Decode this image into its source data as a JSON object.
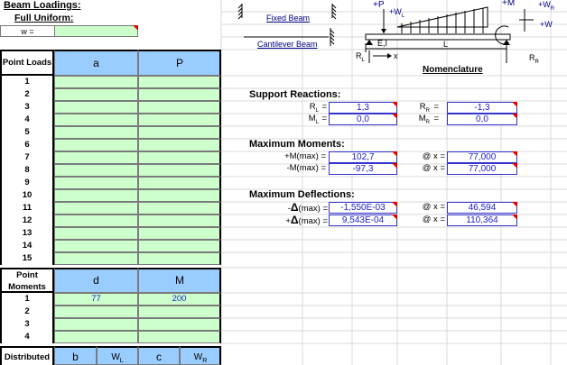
{
  "header": {
    "beam_loadings": "Beam Loadings:",
    "full_uniform": "Full Uniform:",
    "w_label": "w ="
  },
  "point_loads": {
    "title": "Point Loads",
    "col_a": "a",
    "col_p": "P",
    "rows": [
      "1",
      "2",
      "3",
      "4",
      "5",
      "6",
      "7",
      "8",
      "9",
      "10",
      "11",
      "12",
      "13",
      "14",
      "15"
    ]
  },
  "point_moments": {
    "title_line1": "Point",
    "title_line2": "Moments",
    "col_d": "d",
    "col_m": "M",
    "rows": [
      {
        "n": "1",
        "d": "77",
        "m": "200"
      },
      {
        "n": "2",
        "d": "",
        "m": ""
      },
      {
        "n": "3",
        "d": "",
        "m": ""
      },
      {
        "n": "4",
        "d": "",
        "m": ""
      }
    ]
  },
  "distributed": {
    "title": "Distributed",
    "col_b": "b",
    "col_wl": "W",
    "col_wl_sub": "L",
    "col_c": "c",
    "col_wr": "W",
    "col_wr_sub": "R"
  },
  "links": {
    "fixed_beam": "Fixed Beam",
    "cantilever_beam": "Cantilever Beam"
  },
  "diagram": {
    "p_label": "+P",
    "wl_label": "+W",
    "wl_sub": "L",
    "m_label": "+M",
    "wr_label": "+W",
    "wr_sub": "R",
    "w_label": "+W",
    "ei_label": "E,I",
    "l_label": "L",
    "rl_label": "R",
    "rl_sub": "L",
    "rr_label": "R",
    "rr_sub": "R",
    "x_label": "x",
    "nomenclature": "Nomenclature"
  },
  "support_reactions": {
    "title": "Support Reactions:",
    "rl_label": "R",
    "rl_sub": "L",
    "rl_value": "1,3",
    "ml_label": "M",
    "ml_sub": "L",
    "ml_value": "0,0",
    "rr_label": "R",
    "rr_sub": "R",
    "rr_value": "-1,3",
    "mr_label": "M",
    "mr_sub": "R",
    "mr_value": "0,0",
    "eq": "="
  },
  "max_moments": {
    "title": "Maximum Moments:",
    "pos_label": "+M(max) =",
    "pos_value": "102,7",
    "neg_label": "-M(max) =",
    "neg_value": "-97,3",
    "at_x": "@ x =",
    "pos_x": "77,000",
    "neg_x": "77,000"
  },
  "max_deflections": {
    "title": "Maximum Deflections:",
    "neg_prefix": "-",
    "pos_prefix": "+",
    "delta": "Δ",
    "max_suffix": "(max) =",
    "neg_value": "-1,550E-03",
    "pos_value": "9,543E-04",
    "at_x": "@ x =",
    "neg_x": "46,594",
    "pos_x": "110,364"
  },
  "colors": {
    "input_green": "#ccffcc",
    "header_blue": "#99ccff",
    "output_blue_text": "#1a1acc",
    "marker_red": "#e00000"
  }
}
